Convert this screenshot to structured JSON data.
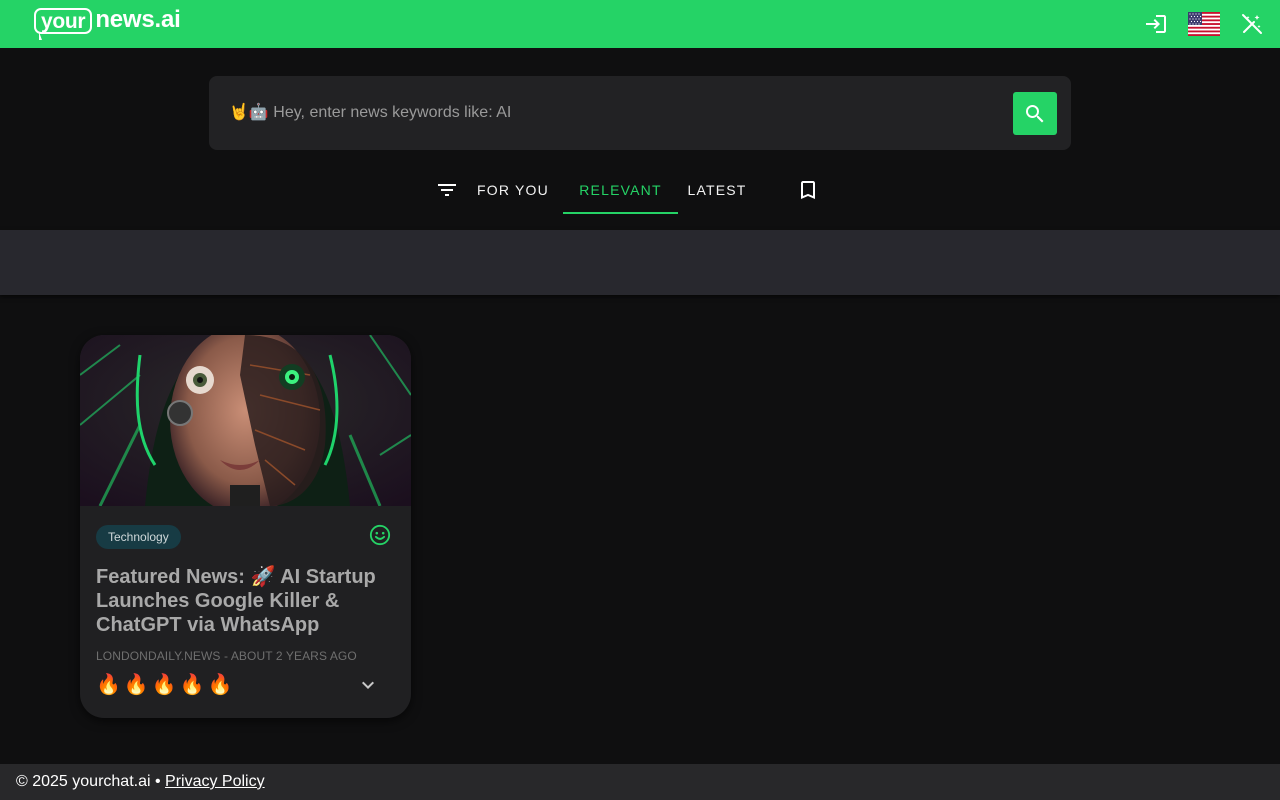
{
  "header": {
    "logo_word": "your",
    "logo_rest": "news.ai",
    "brand_color": "#25d366",
    "icons": [
      "login-icon",
      "us-flag-icon",
      "magic-wand-off-icon"
    ]
  },
  "search": {
    "placeholder": "🤘🤖 Hey, enter news keywords like: AI",
    "value": ""
  },
  "tabs": [
    {
      "label": "FOR YOU",
      "active": false
    },
    {
      "label": "RELEVANT",
      "active": true
    },
    {
      "label": "LATEST",
      "active": false
    }
  ],
  "card": {
    "category": "Technology",
    "title": "Featured News: 🚀 AI Startup Launches Google Killer & ChatGPT via WhatsApp",
    "meta": "LONDONDAILY.NEWS - ABOUT 2 YEARS AGO",
    "rating": "🔥🔥🔥🔥🔥"
  },
  "footer": {
    "copyright": "© 2025 yourchat.ai • ",
    "privacy_link": "Privacy Policy"
  }
}
